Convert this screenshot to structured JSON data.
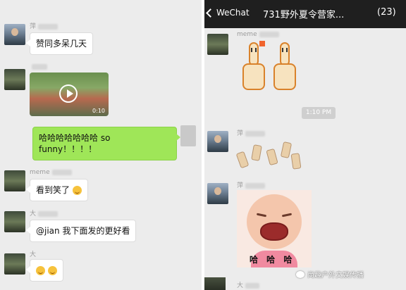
{
  "left_chat": {
    "messages": [
      {
        "sender": "萍",
        "text": "赞同多呆几天"
      },
      {
        "sender": "",
        "video_duration": "0:10"
      },
      {
        "sender": "",
        "text": "哈哈哈哈哈哈哈 so funny！！！！"
      },
      {
        "sender": "meme",
        "text": "看到笑了"
      },
      {
        "sender": "大",
        "text": "@jian 我下面发的更好看"
      },
      {
        "sender": "大",
        "text": ""
      }
    ]
  },
  "right_chat": {
    "header": {
      "back_label": "WeChat",
      "title": "731野外夏令营家...",
      "member_count": "(23)"
    },
    "messages": [
      {
        "sender": "meme"
      },
      {
        "timestamp": "1:10 PM"
      },
      {
        "sender": "萍"
      },
      {
        "sender": "萍",
        "sticker_caption": "哈 哈 哈"
      },
      {
        "sender": "大"
      }
    ],
    "watermark": "尚趣户外文娱传播"
  }
}
